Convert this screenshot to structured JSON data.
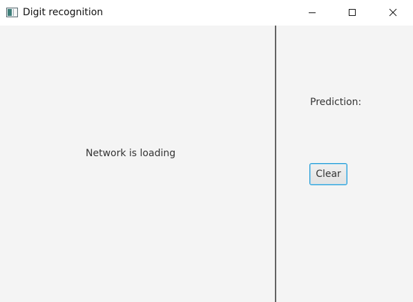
{
  "window": {
    "title": "Digit recognition",
    "icons": {
      "app": "app-window-icon",
      "minimize": "minimize-icon",
      "maximize": "maximize-icon",
      "close": "close-icon"
    }
  },
  "left_pane": {
    "status_text": "Network is loading"
  },
  "right_pane": {
    "prediction_label": "Prediction:",
    "clear_button_label": "Clear"
  },
  "colors": {
    "background": "#f4f4f4",
    "titlebar": "#ffffff",
    "divider": "#616161",
    "button_focus_border": "#1e9ad6"
  }
}
